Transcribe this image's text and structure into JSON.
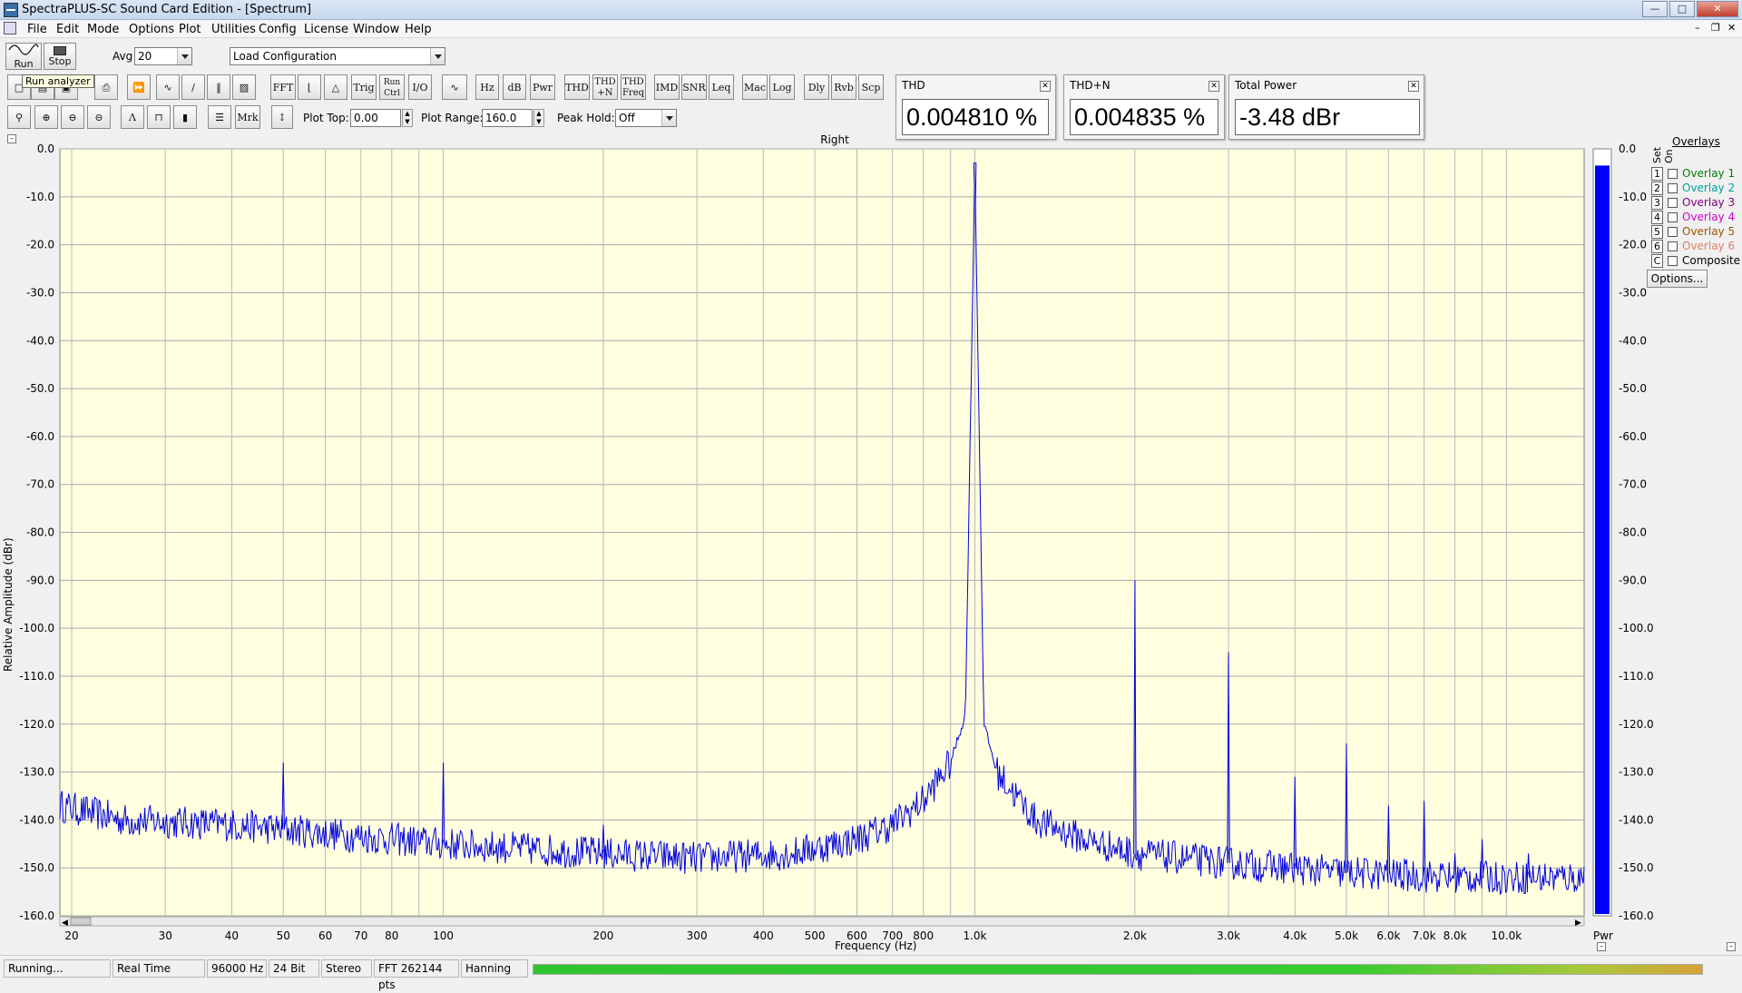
{
  "window": {
    "title": "SpectraPLUS-SC Sound Card Edition - [Spectrum]"
  },
  "menu": [
    "File",
    "Edit",
    "Mode",
    "Options",
    "Plot",
    "Utilities",
    "Config",
    "License",
    "Window",
    "Help"
  ],
  "toolbar": {
    "run_label": "Run",
    "stop_label": "Stop",
    "tooltip": "Run analyzer",
    "avg_label": "Avg",
    "avg_value": "20",
    "config_value": "Load Configuration",
    "row2_buttons": [
      "FFT",
      "Trig",
      "Run Ctrl",
      "I/O",
      "Hz",
      "dB",
      "Pwr",
      "THD",
      "THD +N",
      "THD Freq",
      "IMD",
      "SNR",
      "Leq",
      "Mac",
      "Log",
      "Dly",
      "Rvb",
      "Scp"
    ],
    "row3_buttons": [
      "Mrk"
    ],
    "plot_top_label": "Plot Top:",
    "plot_top_value": "0.00",
    "plot_range_label": "Plot Range:",
    "plot_range_value": "160.0",
    "peak_hold_label": "Peak Hold:",
    "peak_hold_value": "Off"
  },
  "meters": [
    {
      "title": "THD",
      "value": "0.004810 %"
    },
    {
      "title": "THD+N",
      "value": "0.004835 %"
    },
    {
      "title": "Total Power",
      "value": "-3.48 dBr"
    }
  ],
  "plot": {
    "title": "Right",
    "ylabel": "Relative Amplitude (dBr)",
    "xlabel": "Frequency (Hz)",
    "pwr_label": "Pwr",
    "colors": {
      "background": "#ffffe0",
      "trace": "#0000dd",
      "grid": "#a0a0a0",
      "power_bar": "#0000ff"
    }
  },
  "chart_data": {
    "type": "line",
    "xscale": "log",
    "xlim": [
      19,
      14000
    ],
    "ylim": [
      -160,
      0
    ],
    "yticks": [
      "0.0",
      "-10.0",
      "-20.0",
      "-30.0",
      "-40.0",
      "-50.0",
      "-60.0",
      "-70.0",
      "-80.0",
      "-90.0",
      "-100.0",
      "-110.0",
      "-120.0",
      "-130.0",
      "-140.0",
      "-150.0",
      "-160.0"
    ],
    "xticks": [
      {
        "v": 20,
        "t": "20"
      },
      {
        "v": 30,
        "t": "30"
      },
      {
        "v": 40,
        "t": "40"
      },
      {
        "v": 50,
        "t": "50"
      },
      {
        "v": 60,
        "t": "60"
      },
      {
        "v": 70,
        "t": "70"
      },
      {
        "v": 80,
        "t": "80"
      },
      {
        "v": 100,
        "t": "100"
      },
      {
        "v": 200,
        "t": "200"
      },
      {
        "v": 300,
        "t": "300"
      },
      {
        "v": 400,
        "t": "400"
      },
      {
        "v": 500,
        "t": "500"
      },
      {
        "v": 600,
        "t": "600"
      },
      {
        "v": 700,
        "t": "700"
      },
      {
        "v": 800,
        "t": "800"
      },
      {
        "v": 1000,
        "t": "1.0k"
      },
      {
        "v": 2000,
        "t": "2.0k"
      },
      {
        "v": 3000,
        "t": "3.0k"
      },
      {
        "v": 4000,
        "t": "4.0k"
      },
      {
        "v": 5000,
        "t": "5.0k"
      },
      {
        "v": 6000,
        "t": "6.0k"
      },
      {
        "v": 7000,
        "t": "7.0k"
      },
      {
        "v": 8000,
        "t": "8.0k"
      },
      {
        "v": 10000,
        "t": "10.0k"
      }
    ],
    "grid": true,
    "baseline": [
      [
        19,
        -137
      ],
      [
        25,
        -140
      ],
      [
        40,
        -141
      ],
      [
        100,
        -145
      ],
      [
        200,
        -147
      ],
      [
        300,
        -148
      ],
      [
        450,
        -147
      ],
      [
        600,
        -144
      ],
      [
        700,
        -141
      ],
      [
        800,
        -136
      ],
      [
        900,
        -128
      ],
      [
        960,
        -118
      ],
      [
        1000,
        -3
      ],
      [
        1040,
        -120
      ],
      [
        1100,
        -130
      ],
      [
        1300,
        -140
      ],
      [
        1600,
        -144
      ],
      [
        2000,
        -147
      ],
      [
        3000,
        -149
      ],
      [
        5000,
        -151
      ],
      [
        8000,
        -152
      ],
      [
        14000,
        -152
      ]
    ],
    "peaks": [
      {
        "f": 50,
        "db": -128
      },
      {
        "f": 100,
        "db": -128
      },
      {
        "f": 200,
        "db": -141
      },
      {
        "f": 1000,
        "db": -3
      },
      {
        "f": 2000,
        "db": -90
      },
      {
        "f": 3000,
        "db": -105
      },
      {
        "f": 4000,
        "db": -131
      },
      {
        "f": 5000,
        "db": -124
      },
      {
        "f": 6000,
        "db": -137
      },
      {
        "f": 7000,
        "db": -136
      },
      {
        "f": 8000,
        "db": -147
      },
      {
        "f": 9000,
        "db": -144
      },
      {
        "f": 11000,
        "db": -147
      }
    ],
    "power_bar_db": -3.48
  },
  "overlays": {
    "title": "Overlays",
    "set_header": "Set",
    "on_header": "On",
    "items": [
      {
        "num": "1",
        "name": "Overlay 1",
        "color": "#008000"
      },
      {
        "num": "2",
        "name": "Overlay 2",
        "color": "#00a0a0"
      },
      {
        "num": "3",
        "name": "Overlay 3",
        "color": "#800080"
      },
      {
        "num": "4",
        "name": "Overlay 4",
        "color": "#d000d0"
      },
      {
        "num": "5",
        "name": "Overlay 5",
        "color": "#a05000"
      },
      {
        "num": "6",
        "name": "Overlay 6",
        "color": "#e08060"
      },
      {
        "num": "C",
        "name": "Composite",
        "color": "#000000"
      }
    ],
    "options_label": "Options..."
  },
  "status": {
    "state": "Running...",
    "mode": "Real Time",
    "rate": "96000 Hz",
    "bits": "24 Bit",
    "channels": "Stereo",
    "fft": "FFT 262144 pts",
    "window": "Hanning"
  }
}
